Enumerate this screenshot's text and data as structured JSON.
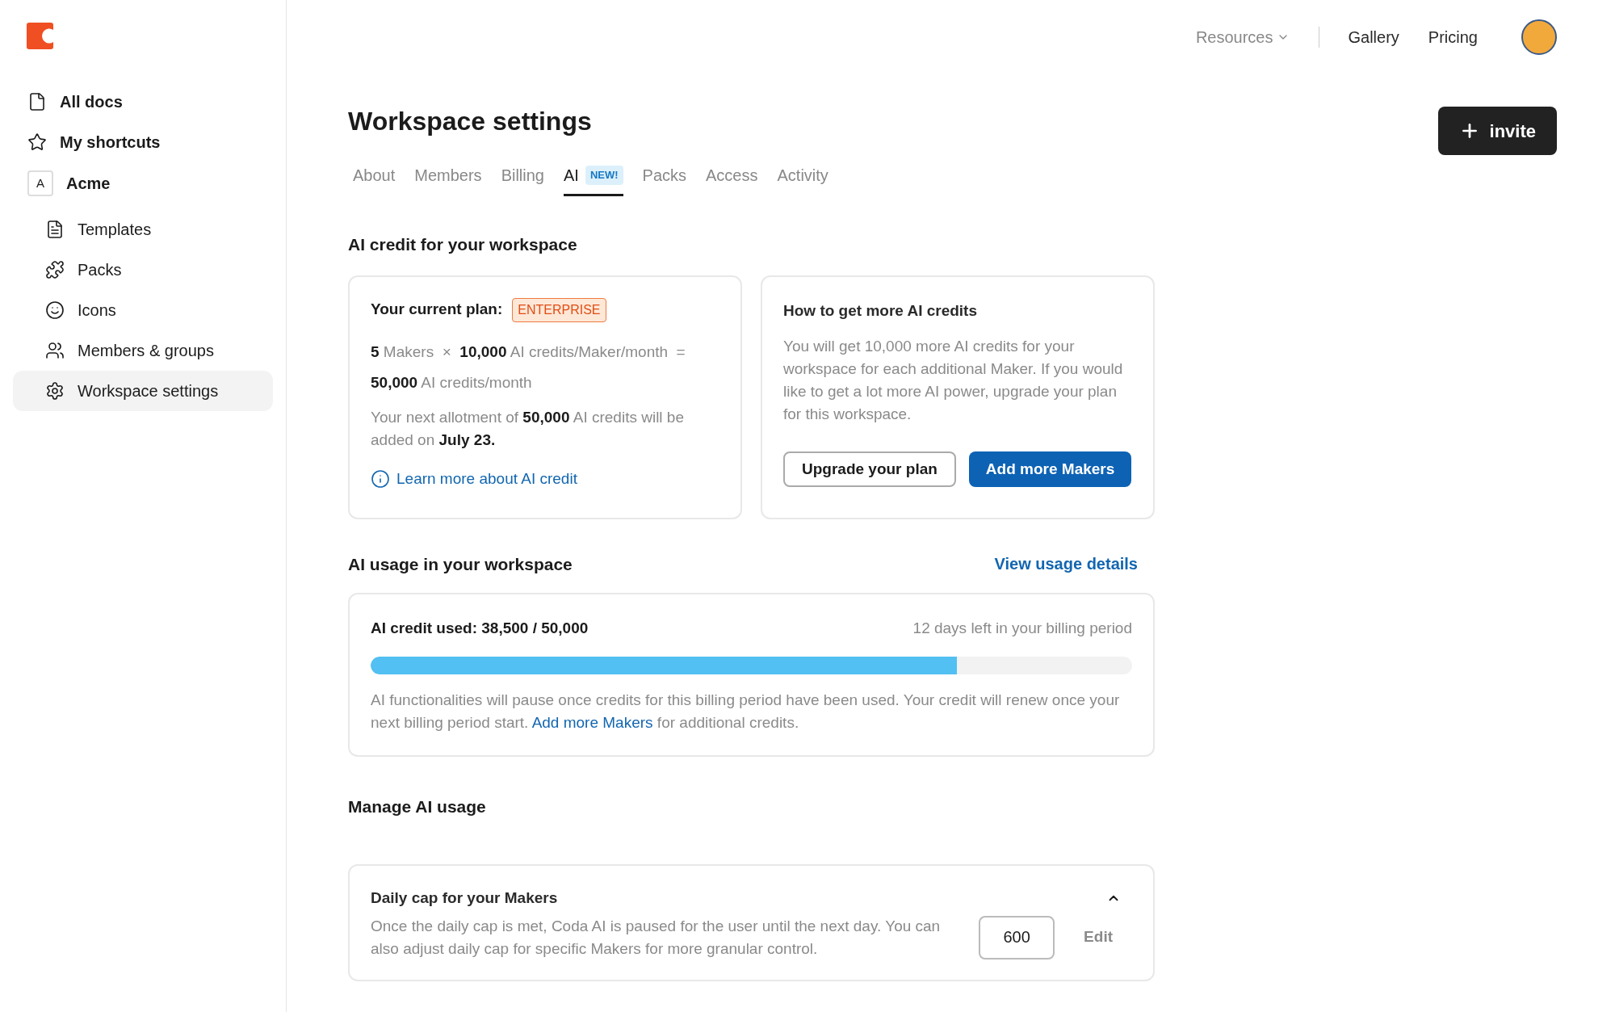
{
  "sidebar": {
    "items": [
      {
        "kind": "top",
        "label": "All docs",
        "selected": false
      },
      {
        "kind": "top",
        "label": "My shortcuts",
        "selected": false
      },
      {
        "kind": "workspace",
        "initial": "A",
        "label": "Acme",
        "selected": false
      },
      {
        "kind": "child",
        "label": "Templates",
        "selected": false
      },
      {
        "kind": "child",
        "label": "Packs",
        "selected": false
      },
      {
        "kind": "child",
        "label": "Icons",
        "selected": false
      },
      {
        "kind": "child",
        "label": "Members & groups",
        "selected": false
      },
      {
        "kind": "child",
        "label": "Workspace settings",
        "selected": true
      }
    ]
  },
  "top_nav": {
    "resources": "Resources",
    "links": [
      "Gallery",
      "Pricing"
    ]
  },
  "invite_button": "invite",
  "page_title": "Workspace settings",
  "tabs": [
    {
      "label": "About",
      "selected": false
    },
    {
      "label": "Members",
      "selected": false
    },
    {
      "label": "Billing",
      "selected": false
    },
    {
      "label": "AI",
      "badge": "NEW!",
      "selected": true
    },
    {
      "label": "Packs",
      "selected": false
    },
    {
      "label": "Access",
      "selected": false
    },
    {
      "label": "Activity",
      "selected": false
    }
  ],
  "credit_section": {
    "title": "AI credit for your workspace",
    "plan_card": {
      "label": "Your current plan:",
      "plan": "ENTERPRISE",
      "formula": "**5** Makers  ×  **10,000** AI credits/Maker/month  =  **50,000** AI credits/month",
      "allotment": "Your next allotment of **50,000** AI credits will be added on **July 23.**",
      "link": "Learn more about AI credit"
    },
    "more_card": {
      "title": "How to get more AI credits",
      "text": "You will get 10,000 more AI credits for your workspace for each additional Maker. If you would like to get a lot more AI power, upgrade your plan for this workspace.",
      "buttons": [
        {
          "label": "Upgrade your plan",
          "kind": "secondary"
        },
        {
          "label": "Add more Makers",
          "kind": "primary"
        }
      ]
    }
  },
  "usage_section": {
    "title": "AI usage in your workspace",
    "link": "View usage details",
    "used_label": "AI credit used: 38,500 / 50,000",
    "days_left": "12 days left in your billing period",
    "level": 0.77,
    "note_before": "AI functionalities will pause once credits for this billing period have been used. Your credit will renew once your next billing period start.",
    "note_link": "Add more Makers",
    "note_after": "for additional credits."
  },
  "manage_section": {
    "title": "Manage AI usage",
    "cap_card": {
      "title": "Daily cap for your Makers",
      "expanded": true,
      "text": "Once the daily cap is met, Coda AI is paused for the user until the next day. You can also adjust daily cap for specific Makers for more granular control.",
      "value": "600",
      "edit": "Edit"
    }
  }
}
